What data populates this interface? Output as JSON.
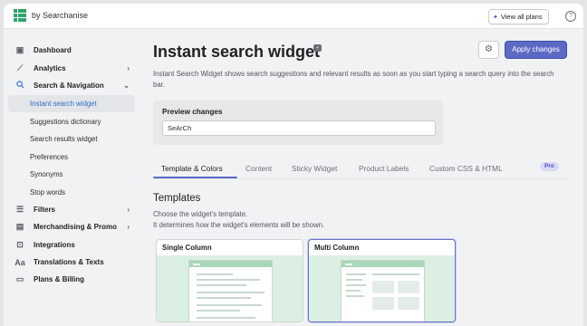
{
  "topbar": {
    "brand": "by Searchanise",
    "view_plans_label": "View all plans",
    "view_plans_icon": "sparkle-icon",
    "help_icon": "question-circle-icon"
  },
  "sidebar": {
    "items": [
      {
        "label": "Dashboard",
        "icon": "dashboard-icon",
        "chevron": ""
      },
      {
        "label": "Analytics",
        "icon": "analytics-icon",
        "chevron": "›"
      },
      {
        "label": "Search & Navigation",
        "icon": "search-icon",
        "chevron": "⌄"
      },
      {
        "label": "Filters",
        "icon": "filters-icon",
        "chevron": "›"
      },
      {
        "label": "Merchandising & Promo",
        "icon": "merchandising-icon",
        "chevron": "›"
      },
      {
        "label": "Integrations",
        "icon": "integrations-icon",
        "chevron": ""
      },
      {
        "label": "Translations & Texts",
        "icon": "translations-icon",
        "chevron": ""
      },
      {
        "label": "Plans & Billing",
        "icon": "billing-icon",
        "chevron": ""
      }
    ],
    "sub_items": [
      {
        "label": "Instant search widget",
        "active": true
      },
      {
        "label": "Suggestions dictionary",
        "active": false
      },
      {
        "label": "Search results widget",
        "active": false
      },
      {
        "label": "Preferences",
        "active": false
      },
      {
        "label": "Synonyms",
        "active": false
      },
      {
        "label": "Stop words",
        "active": false
      }
    ]
  },
  "page": {
    "title": "Instant search widget",
    "apply_label": "Apply changes",
    "description": "Instant Search Widget shows search suggestions and relevant results as soon as you start typing a search query into the search bar."
  },
  "preview": {
    "title": "Preview changes",
    "input_value": "SeArCh"
  },
  "tabs": [
    {
      "label": "Template & Colors",
      "active": true
    },
    {
      "label": "Content",
      "active": false
    },
    {
      "label": "Sticky Widget",
      "active": false
    },
    {
      "label": "Product Labels",
      "active": false
    },
    {
      "label": "Custom CSS & HTML",
      "active": false
    }
  ],
  "pro_badge": "Pro",
  "templates": {
    "title": "Templates",
    "desc_line1": "Choose the widget's template.",
    "desc_line2": "It determines how the widget's elements will be shown.",
    "options": [
      {
        "label": "Single Column",
        "selected": false
      },
      {
        "label": "Multi Column",
        "selected": true
      }
    ]
  },
  "colors": {
    "accent": "#5c6ac4",
    "active_link": "#2c6ecb",
    "template_bg": "#dcefe3"
  }
}
